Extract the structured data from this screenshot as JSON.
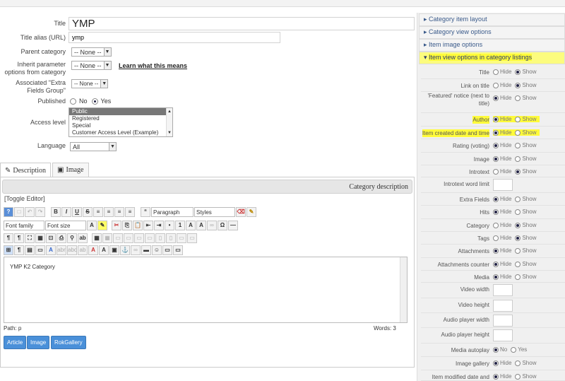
{
  "form": {
    "title_label": "Title",
    "title_value": "YMP",
    "alias_label": "Title alias (URL)",
    "alias_value": "ymp",
    "parent_label": "Parent category",
    "parent_value": "-- None --",
    "inherit_label_1": "Inherit parameter",
    "inherit_label_2": "options from category",
    "inherit_value": "-- None --",
    "learn_link": "Learn what this means",
    "extra_label_1": "Associated \"Extra",
    "extra_label_2": "Fields Group\"",
    "extra_value": "-- None --",
    "published_label": "Published",
    "published_no": "No",
    "published_yes": "Yes",
    "access_label": "Access level",
    "access_options": [
      "Public",
      "Registered",
      "Special",
      "Customer Access Level (Example)"
    ],
    "language_label": "Language",
    "language_value": "All"
  },
  "tabs": [
    {
      "label": "Description",
      "icon": "pencil-icon",
      "active": true
    },
    {
      "label": "Image",
      "icon": "image-icon",
      "active": false
    }
  ],
  "editor": {
    "header": "Category description",
    "toggle": "[Toggle Editor]",
    "format_select": "Paragraph",
    "styles_select": "Styles",
    "font_family": "Font family",
    "font_size": "Font size",
    "content": "YMP K2 Category",
    "path": "Path: p",
    "words": "Words: 3",
    "buttons": [
      "Article",
      "Image",
      "RokGallery"
    ]
  },
  "panel": {
    "sections": [
      {
        "label": "Category item layout",
        "open": false
      },
      {
        "label": "Category view options",
        "open": false
      },
      {
        "label": "Item image options",
        "open": false
      },
      {
        "label": "Item view options in category listings",
        "open": true
      }
    ],
    "hide": "Hide",
    "show": "Show",
    "no": "No",
    "yes": "Yes",
    "rows": [
      {
        "label": "Title",
        "type": "hs",
        "value": "Show"
      },
      {
        "label": "Link on title",
        "type": "hs",
        "value": "Show"
      },
      {
        "label": "'Featured' notice (next to title)",
        "type": "hs",
        "value": "Hide"
      },
      {
        "label": "Author",
        "type": "hs",
        "value": "Hide",
        "highlight": true
      },
      {
        "label": "Item created date and time",
        "type": "hs",
        "value": "Hide",
        "highlight": true
      },
      {
        "label": "Rating (voting)",
        "type": "hs",
        "value": "Hide"
      },
      {
        "label": "Image",
        "type": "hs",
        "value": "Hide"
      },
      {
        "label": "Introtext",
        "type": "hs",
        "value": "Show"
      },
      {
        "label": "Introtext word limit",
        "type": "input"
      },
      {
        "label": "Extra Fields",
        "type": "hs",
        "value": "Hide"
      },
      {
        "label": "Hits",
        "type": "hs",
        "value": "Hide"
      },
      {
        "label": "Category",
        "type": "hs",
        "value": "Show"
      },
      {
        "label": "Tags",
        "type": "hs",
        "value": "Show"
      },
      {
        "label": "Attachments",
        "type": "hs",
        "value": "Hide"
      },
      {
        "label": "Attachments counter",
        "type": "hs",
        "value": "Hide"
      },
      {
        "label": "Media",
        "type": "hs",
        "value": "Hide"
      },
      {
        "label": "Video width",
        "type": "input"
      },
      {
        "label": "Video height",
        "type": "input"
      },
      {
        "label": "Audio player width",
        "type": "input"
      },
      {
        "label": "Audio player height",
        "type": "input"
      },
      {
        "label": "Media autoplay",
        "type": "ny",
        "value": "No"
      },
      {
        "label": "Image gallery",
        "type": "hs",
        "value": "Hide"
      },
      {
        "label": "Item modified date and",
        "type": "hs",
        "value": "Hide"
      }
    ]
  }
}
